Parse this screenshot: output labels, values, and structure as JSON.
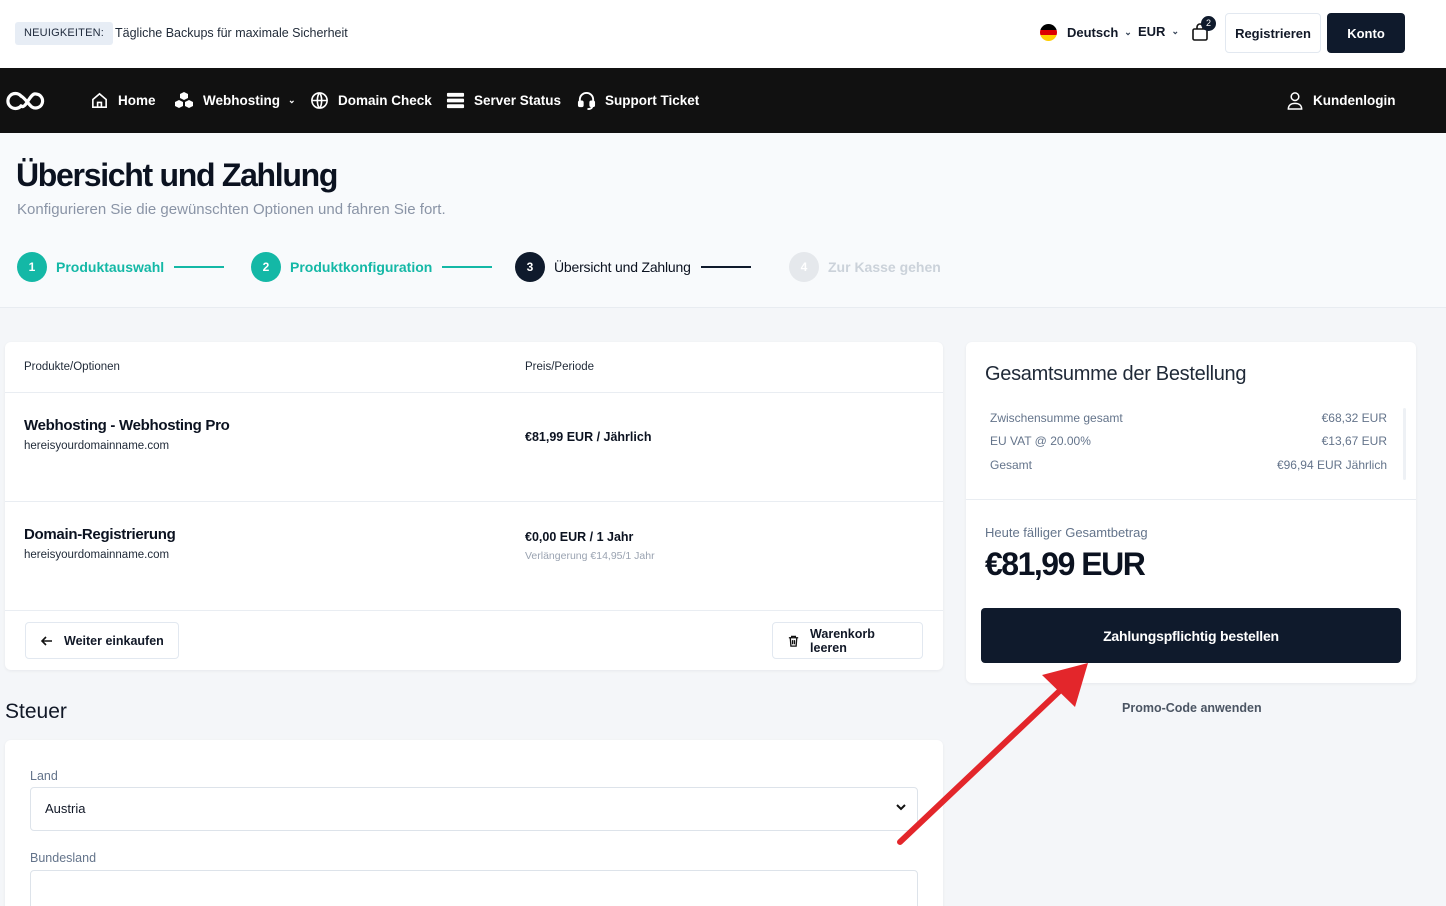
{
  "topbar": {
    "news_badge": "NEUIGKEITEN:",
    "news_text": "Tägliche Backups für maximale Sicherheit",
    "language": "Deutsch",
    "currency": "EUR",
    "cart_count": "2",
    "register": "Registrieren",
    "account": "Konto"
  },
  "nav": {
    "items": [
      {
        "label": "Home",
        "icon": "home-icon"
      },
      {
        "label": "Webhosting",
        "icon": "cubes-icon"
      },
      {
        "label": "Domain Check",
        "icon": "globe-icon"
      },
      {
        "label": "Server Status",
        "icon": "server-icon"
      },
      {
        "label": "Support Ticket",
        "icon": "headset-icon"
      }
    ],
    "login": "Kundenlogin"
  },
  "page": {
    "title": "Übersicht und Zahlung",
    "subtitle": "Konfigurieren Sie die gewünschten Optionen und fahren Sie fort."
  },
  "steps": [
    {
      "num": "1",
      "label": "Produktauswahl",
      "state": "done"
    },
    {
      "num": "2",
      "label": "Produktkonfiguration",
      "state": "done"
    },
    {
      "num": "3",
      "label": "Übersicht und Zahlung",
      "state": "active"
    },
    {
      "num": "4",
      "label": "Zur Kasse gehen",
      "state": "todo"
    }
  ],
  "products": {
    "col_products": "Produkte/Optionen",
    "col_price": "Preis/Periode",
    "rows": [
      {
        "name": "Webhosting - Webhosting Pro",
        "domain": "hereisyourdomainname.com",
        "price": "€81,99 EUR / Jährlich",
        "renewal": ""
      },
      {
        "name": "Domain-Registrierung",
        "domain": "hereisyourdomainname.com",
        "price": "€0,00 EUR / 1 Jahr",
        "renewal": "Verlängerung €14,95/1 Jahr"
      }
    ],
    "continue_shopping": "Weiter einkaufen",
    "empty_cart": "Warenkorb leeren"
  },
  "tax": {
    "title": "Steuer",
    "country_label": "Land",
    "country_value": "Austria",
    "state_label": "Bundesland",
    "state_value": ""
  },
  "summary": {
    "title": "Gesamtsumme der Bestellung",
    "rows": [
      {
        "label": "Zwischensumme gesamt",
        "value": "€68,32 EUR"
      },
      {
        "label": "EU VAT @ 20.00%",
        "value": "€13,67 EUR"
      },
      {
        "label": "Gesamt",
        "value": "€96,94 EUR Jährlich"
      }
    ],
    "due_label": "Heute fälliger Gesamtbetrag",
    "due_amount": "€81,99 EUR",
    "order_button": "Zahlungspflichtig bestellen",
    "promo": "Promo-Code anwenden"
  },
  "colors": {
    "accent": "#14b8a6",
    "dark": "#0f1a2c",
    "nav_bg": "#111111",
    "arrow": "#e3262b"
  }
}
